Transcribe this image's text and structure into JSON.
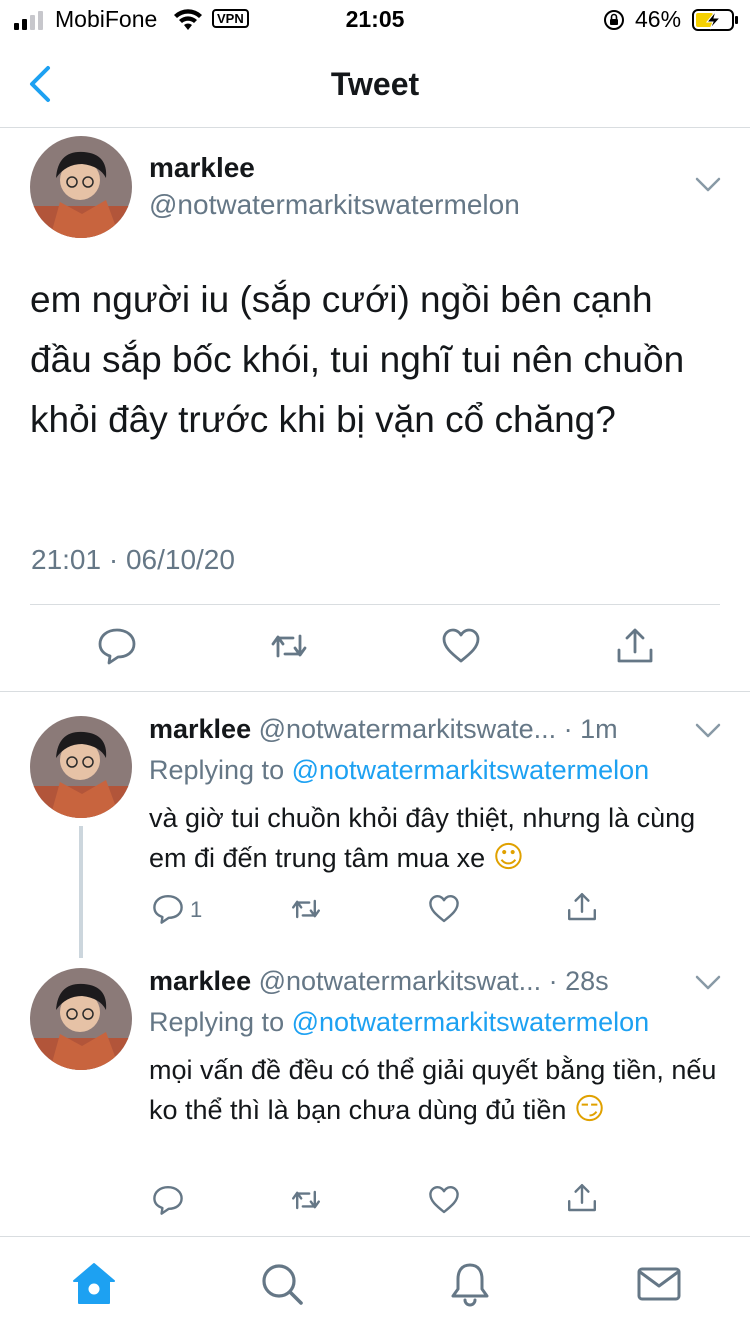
{
  "status_bar": {
    "carrier": "MobiFone",
    "vpn": "VPN",
    "time": "21:05",
    "battery_percent": "46%"
  },
  "nav": {
    "title": "Tweet"
  },
  "main_tweet": {
    "name": "marklee",
    "handle": "@notwatermarkitswatermelon",
    "text": "em người iu (sắp cưới) ngồi bên cạnh đầu sắp bốc khói, tui nghĩ tui nên chuồn khỏi đây trước khi bị vặn cổ chăng?",
    "timestamp": "21:01 · 06/10/20"
  },
  "replies": [
    {
      "name": "marklee",
      "handle": "@notwatermarkitswate...",
      "time": "· 1m",
      "replying_label": "Replying to",
      "replying_to": "@notwatermarkitswatermelon",
      "text": "và giờ tui chuồn khỏi đây thiệt, nhưng là cùng em đi đến trung tâm mua xe",
      "emoji": "☺",
      "reply_count": "1"
    },
    {
      "name": "marklee",
      "handle": "@notwatermarkitswat...",
      "time": "· 28s",
      "replying_label": "Replying to",
      "replying_to": "@notwatermarkitswatermelon",
      "text": "mọi vấn đề đều có thể giải quyết bằng tiền, nếu ko thể thì là bạn chưa dùng đủ tiền",
      "emoji": "😏",
      "reply_count": ""
    }
  ],
  "icons": [
    "back-icon",
    "chevron-down-icon",
    "reply-icon",
    "retweet-icon",
    "like-icon",
    "share-icon",
    "home-icon",
    "search-icon",
    "notifications-icon",
    "messages-icon"
  ],
  "colors": {
    "accent": "#1da1f2",
    "secondary_text": "#657786",
    "icon_gray": "#657786",
    "divider": "#d9dde0"
  }
}
